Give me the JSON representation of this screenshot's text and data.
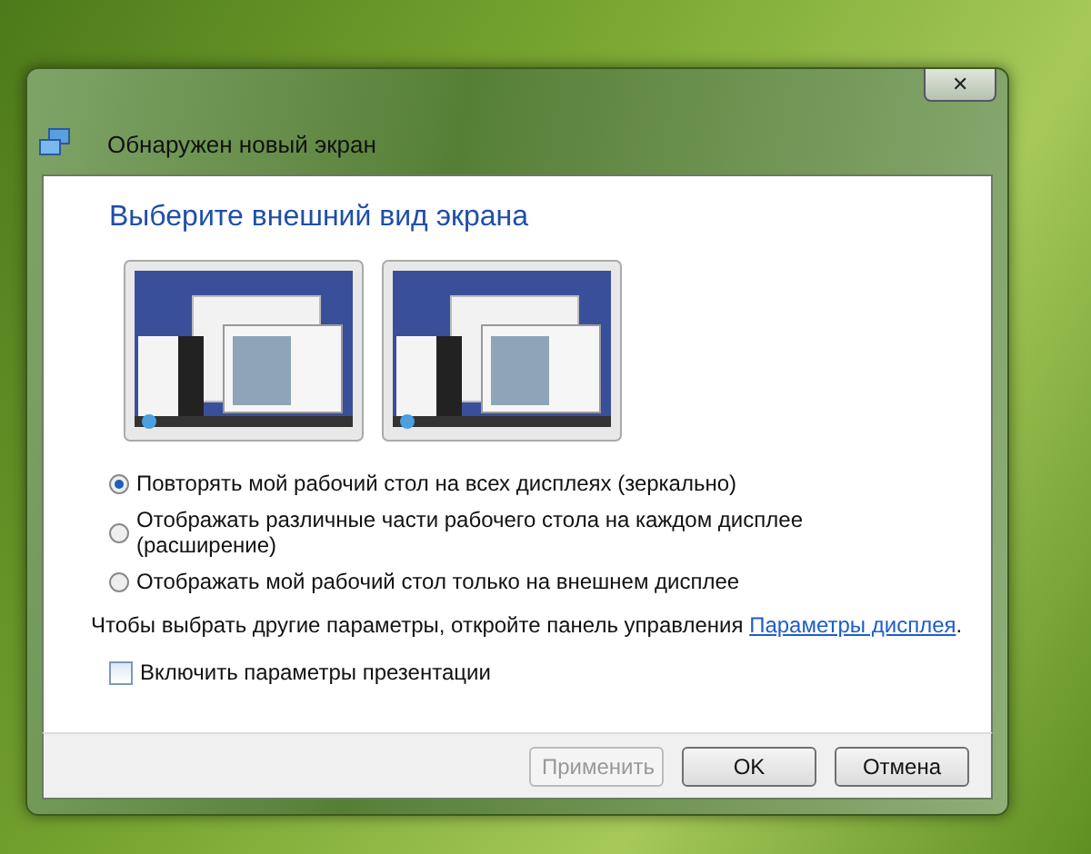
{
  "window": {
    "title": "Обнаружен новый экран",
    "close_label": "✕"
  },
  "heading": "Выберите внешний вид экрана",
  "options": [
    {
      "label": "Повторять мой рабочий стол на всех дисплеях (зеркально)",
      "selected": true
    },
    {
      "label": "Отображать различные части рабочего стола на каждом дисплее (расширение)",
      "selected": false
    },
    {
      "label": "Отображать мой рабочий стол только на внешнем дисплее",
      "selected": false
    }
  ],
  "hint": {
    "text_before": "Чтобы выбрать другие параметры, откройте панель управления ",
    "link": "Параметры дисплея",
    "text_after": "."
  },
  "presentation_checkbox": {
    "label": "Включить параметры презентации",
    "checked": false
  },
  "buttons": [
    {
      "label": "Применить",
      "disabled": true
    },
    {
      "label": "OK",
      "disabled": false
    },
    {
      "label": "Отмена",
      "disabled": false
    }
  ]
}
